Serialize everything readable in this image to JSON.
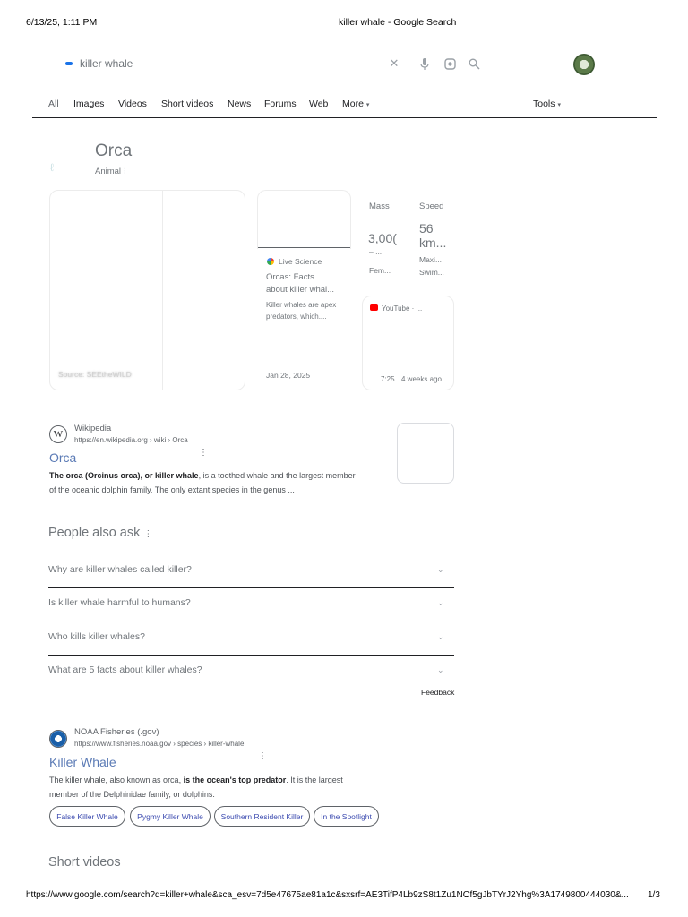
{
  "print_header": {
    "datetime": "6/13/25, 1:11 PM",
    "page_title": "killer whale - Google Search"
  },
  "search": {
    "query": "killer whale",
    "icons": [
      "clear-icon",
      "microphone-icon",
      "lens-icon",
      "search-icon"
    ]
  },
  "tabs": [
    {
      "label": "All",
      "active": true
    },
    {
      "label": "Images"
    },
    {
      "label": "Videos"
    },
    {
      "label": "Short videos"
    },
    {
      "label": "News"
    },
    {
      "label": "Forums"
    },
    {
      "label": "Web"
    },
    {
      "label": "More"
    }
  ],
  "tools_label": "Tools",
  "knowledge_panel": {
    "title": "Orca",
    "subtitle": "Animal",
    "image_source": "Source: SEEtheWILD",
    "article_card": {
      "source": "Live Science",
      "title_line1": "Orcas: Facts",
      "title_line2": "about killer whal...",
      "desc_line1": "Killer whales are apex",
      "desc_line2": "predators, which....",
      "date": "Jan 28, 2025"
    },
    "stats": [
      {
        "label": "Mass",
        "value_line1": "3,00(",
        "value_line2": "– ...",
        "sub": "Fem..."
      },
      {
        "label": "Speed",
        "value_line1": "56",
        "value_line2": "km...",
        "sub_line1": "Maxi...",
        "sub_line2": "Swim..."
      }
    ],
    "video_card": {
      "source": "YouTube · ...",
      "duration": "7:25",
      "age": "4 weeks ago"
    }
  },
  "wiki_result": {
    "site": "Wikipedia",
    "url": "https://en.wikipedia.org › wiki › Orca",
    "title": "Orca",
    "snippet_bold": "The orca (Orcinus orca), or killer whale",
    "snippet_rest": ", is a toothed whale and the largest member",
    "snippet_line2": "of the oceanic dolphin family. The only extant species in the genus ..."
  },
  "people_also_ask": {
    "heading": "People also ask",
    "questions": [
      "Why are killer whales called killer?",
      "Is killer whale harmful to humans?",
      "Who kills killer whales?",
      "What are 5 facts about killer whales?"
    ],
    "feedback": "Feedback"
  },
  "noaa_result": {
    "site": "NOAA Fisheries (.gov)",
    "url": "https://www.fisheries.noaa.gov › species › killer-whale",
    "title": "Killer Whale",
    "snippet_a": "The killer whale, also known as orca, ",
    "snippet_bold": "is the ocean's top predator",
    "snippet_b": ". It is the largest",
    "snippet_line2": "member of the Delphinidae family, or dolphins.",
    "chips": [
      "False Killer Whale",
      "Pygmy Killer Whale",
      "Southern Resident Killer",
      "In the Spotlight"
    ]
  },
  "short_videos_heading": "Short videos",
  "print_footer": {
    "url": "https://www.google.com/search?q=killer+whale&sca_esv=7d5e47675ae81a1c&sxsrf=AE3TifP4Lb9zS8t1Zu1NOf5gJbTYrJ2Yhg%3A1749800444030&...",
    "page": "1/3"
  }
}
